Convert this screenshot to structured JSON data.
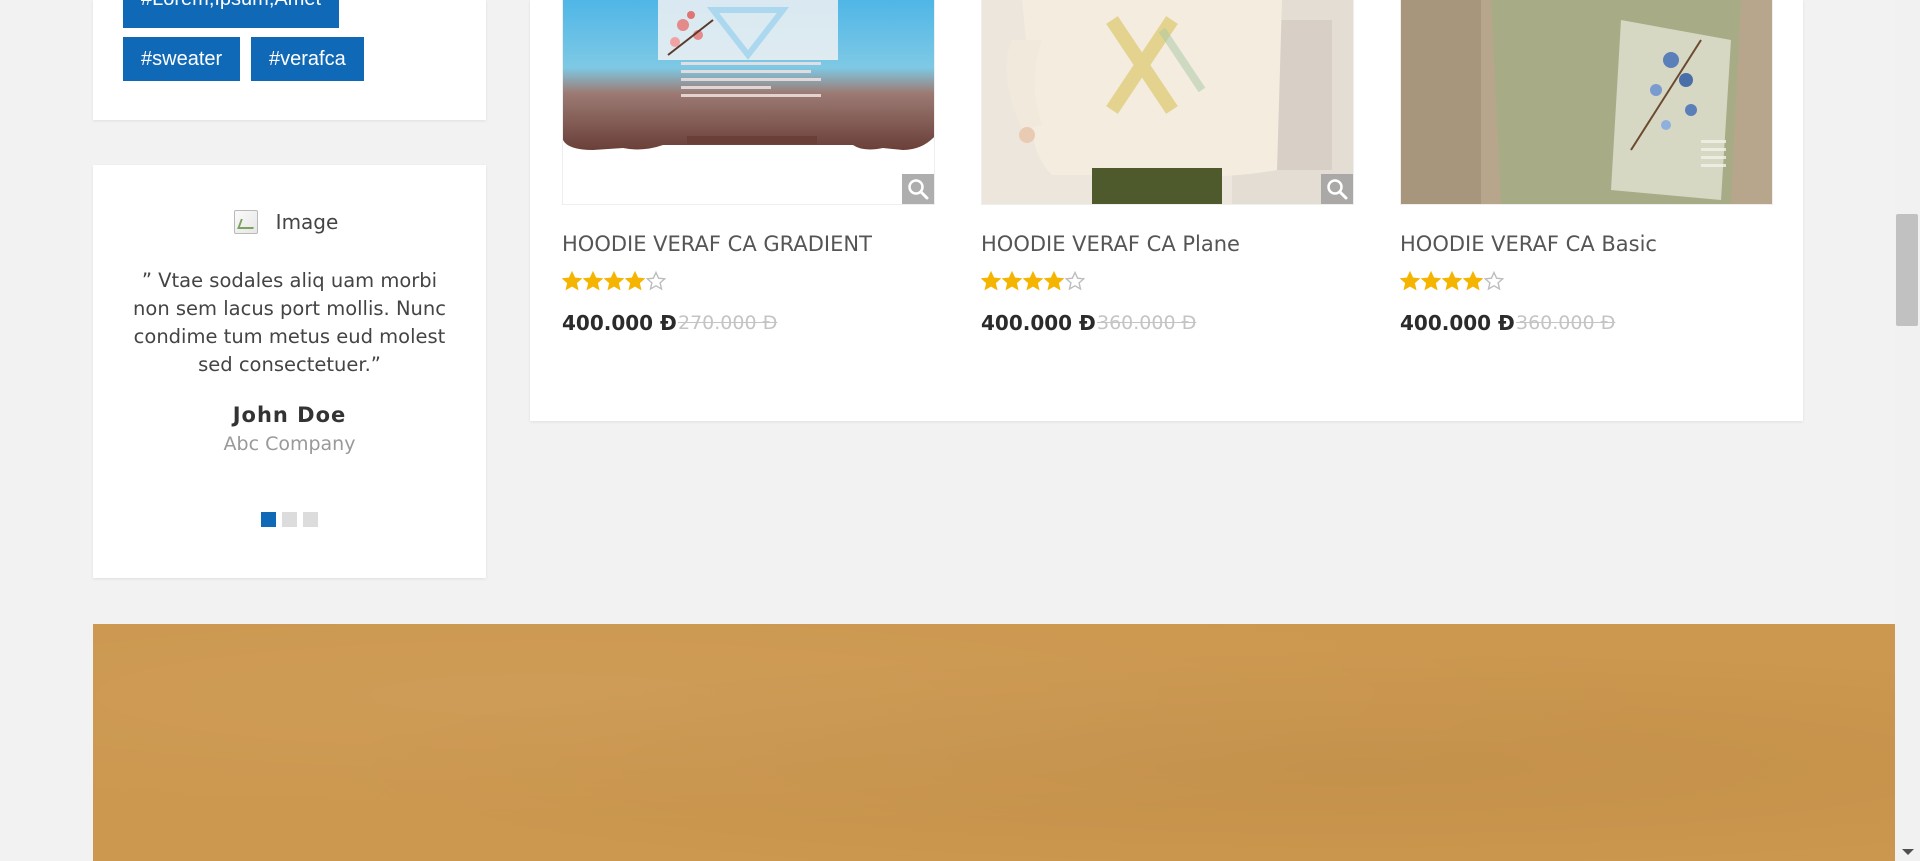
{
  "tags": [
    "#Lorem,Ipsum,Amet",
    "#sweater",
    "#verafca"
  ],
  "testimonial": {
    "image_alt": "Image",
    "quote": "” Vtae sodales aliq uam morbi non sem lacus port mollis. Nunc condime tum metus eud molest sed consectetuer.”",
    "name": "John Doe",
    "company": "Abc Company",
    "slides_total": 3,
    "active_slide": 1
  },
  "products": [
    {
      "name": "HOODIE VERAF CA GRADIENT",
      "price": "400.000 Đ",
      "old_price": "270.000 Đ",
      "rating": 4,
      "rating_max": 5
    },
    {
      "name": "HOODIE VERAF CA Plane",
      "price": "400.000 Đ",
      "old_price": "360.000 Đ",
      "rating": 4,
      "rating_max": 5
    },
    {
      "name": "HOODIE VERAF CA Basic",
      "price": "400.000 Đ",
      "old_price": "360.000 Đ",
      "rating": 4,
      "rating_max": 5
    }
  ],
  "colors": {
    "accent": "#1069b6",
    "star": "#f5b400",
    "banner": "#cc974e"
  },
  "icons": {
    "zoom": "magnifier-icon",
    "rating": "star-icon",
    "broken_image": "broken-image-icon"
  }
}
